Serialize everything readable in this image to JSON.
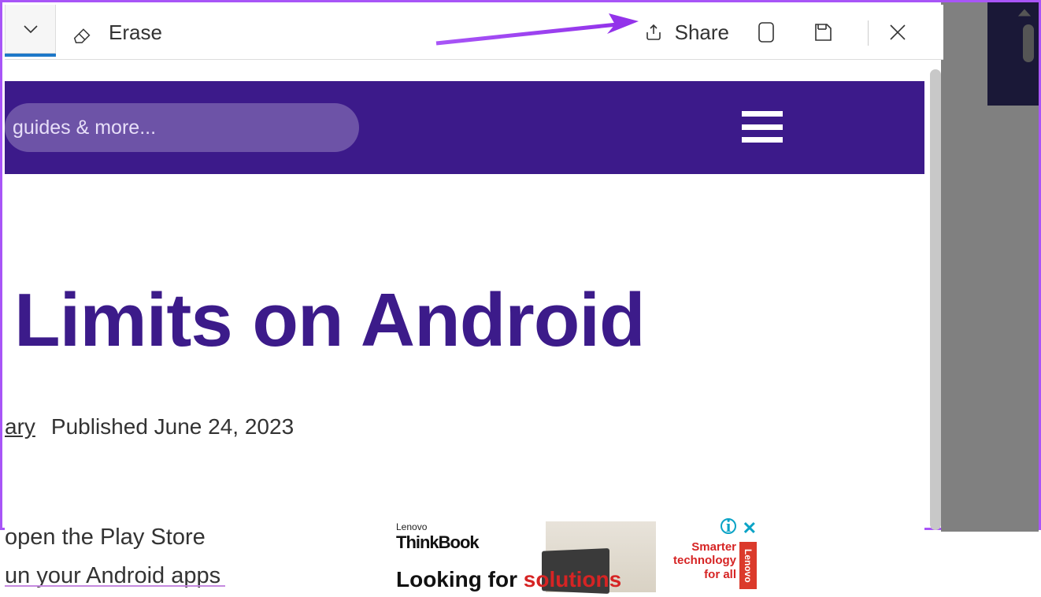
{
  "toolbar": {
    "erase_label": "Erase",
    "share_label": "Share"
  },
  "site": {
    "search_placeholder": "guides & more..."
  },
  "article": {
    "title_fragment": "Limits on Android",
    "author_fragment": "ary",
    "published_label": "Published June 24, 2023",
    "body_line1": "open the Play Store",
    "body_line2": "un your Android apps"
  },
  "ad": {
    "brand_top": "Lenovo",
    "brand_main": "ThinkBook",
    "slogan_l1": "Smarter",
    "slogan_l2": "technology",
    "slogan_l3": "for all",
    "lenovo_tag": "Lenovo",
    "tagline_a": "Looking for ",
    "tagline_b": "solutions",
    "info_glyph": "i",
    "close_glyph": "✕"
  }
}
